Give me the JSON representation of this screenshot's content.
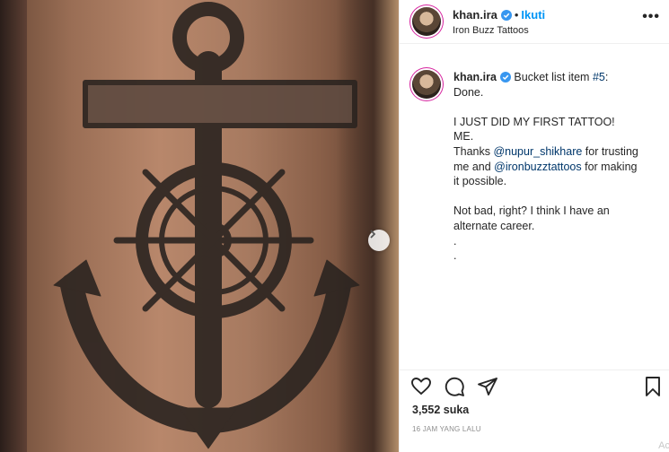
{
  "post": {
    "username": "khan.ira",
    "follow_label": "Ikuti",
    "location": "Iron Buzz Tattoos",
    "caption_lines": [
      "Done.",
      "",
      "I JUST DID MY FIRST TATTOO!",
      "ME.",
      "Thanks @nupur_shikhare for trusting",
      "me and @ironbuzztattoos for making",
      "it possible.",
      "",
      "Not bad, right? I think I have an",
      "alternate career.",
      ".",
      "."
    ],
    "caption_first": "Bucket list item #5:",
    "likes": "3,552 suka",
    "timestamp": "16 JAM YANG LALU",
    "corner_label": "Ac"
  },
  "icons": [
    "heart-icon",
    "comment-icon",
    "share-icon",
    "bookmark-icon",
    "verified-icon",
    "more-icon",
    "chevron-right-icon"
  ],
  "colors": {
    "accent": "#0095f6",
    "verified": "#3897f0",
    "mention": "#00376b",
    "muted": "#8e8e8e"
  }
}
